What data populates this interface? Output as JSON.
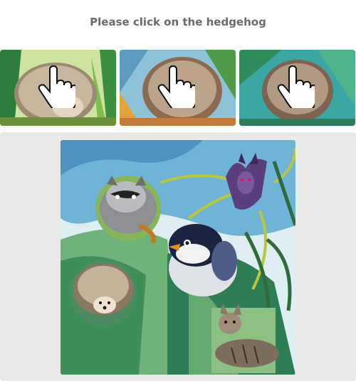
{
  "captcha": {
    "instruction": "Please click on the hedgehog"
  },
  "examples": [
    {
      "animal": "hedgehog",
      "icon": "pointer-hand-icon"
    },
    {
      "animal": "hedgehog",
      "icon": "pointer-hand-icon"
    },
    {
      "animal": "hedgehog",
      "icon": "pointer-hand-icon"
    }
  ],
  "puzzle": {
    "animals": [
      "raccoon",
      "bat",
      "bird",
      "hedgehog",
      "cat"
    ],
    "colors": {
      "panel": "#e9e9e9",
      "watercolor_blue": "#6fb3d6",
      "leaf_green": "#3f8f5b",
      "title_gray": "#6b6b6b"
    }
  }
}
